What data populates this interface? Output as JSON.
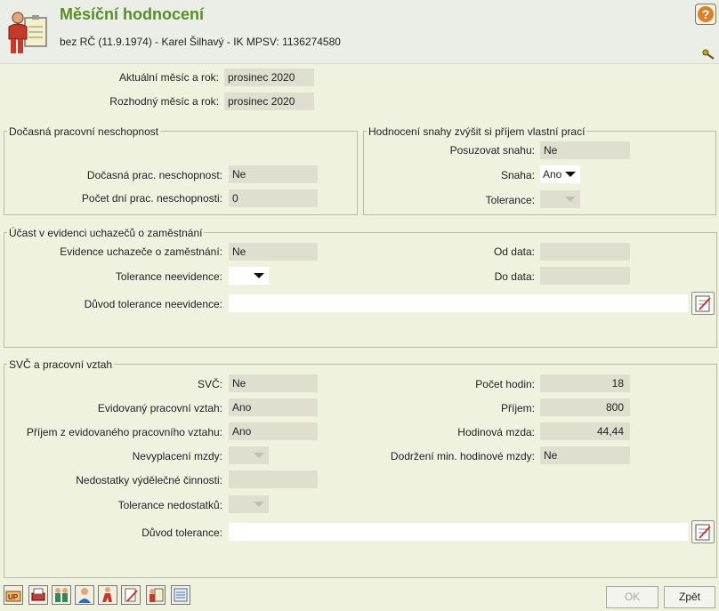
{
  "header": {
    "title": "Měsíční hodnocení",
    "subtitle": "bez RČ (11.9.1974) - Karel Šilhavý - IK MPSV: 1136274580",
    "help_label": "?"
  },
  "top": {
    "current_month_label": "Aktuální měsíc a rok:",
    "current_month_value": "prosinec 2020",
    "decisive_month_label": "Rozhodný měsíc a rok:",
    "decisive_month_value": "prosinec 2020"
  },
  "incapacity": {
    "legend": "Dočasná pracovní neschopnost",
    "incapacity_label": "Dočasná prac. neschopnost:",
    "incapacity_value": "Ne",
    "days_label": "Počet dní prac. neschopnosti:",
    "days_value": "0"
  },
  "effort": {
    "legend": "Hodnocení snahy zvýšit si příjem vlastní prací",
    "assess_label": "Posuzovat snahu:",
    "assess_value": "Ne",
    "effort_label": "Snaha:",
    "effort_value": "Ano",
    "tolerance_label": "Tolerance:",
    "tolerance_value": ""
  },
  "registry": {
    "legend": "Účast v evidenci uchazečů o zaměstnání",
    "evidence_label": "Evidence uchazeče o zaměstnání:",
    "evidence_value": "Ne",
    "from_label": "Od data:",
    "from_value": "",
    "tolerance_label": "Tolerance neevidence:",
    "tolerance_value": "",
    "to_label": "Do data:",
    "to_value": "",
    "reason_label": "Důvod tolerance neevidence:",
    "reason_value": ""
  },
  "svc": {
    "legend": "SVČ a pracovní vztah",
    "svc_label": "SVČ:",
    "svc_value": "Ne",
    "hours_label": "Počet hodin:",
    "hours_value": "18",
    "employment_label": "Evidovaný pracovní vztah:",
    "employment_value": "Ano",
    "income_label": "Příjem:",
    "income_value": "800",
    "income_from_label": "Příjem z evidovaného pracovního vztahu:",
    "income_from_value": "Ano",
    "hourly_label": "Hodinová mzda:",
    "hourly_value": "44,44",
    "nonpayment_label": "Nevyplacení mzdy:",
    "nonpayment_value": "",
    "min_wage_label": "Dodržení min. hodinové mzdy:",
    "min_wage_value": "Ne",
    "shortcomings_label": "Nedostatky výdělečné činnosti:",
    "shortcomings_value": "",
    "shortcomings_tol_label": "Tolerance nedostatků:",
    "shortcomings_tol_value": "",
    "reason_label": "Důvod tolerance:",
    "reason_value": ""
  },
  "footer": {
    "ok_label": "OK",
    "back_label": "Zpět",
    "icons": [
      "up-icon",
      "printer-icon",
      "family-icon",
      "person-icon",
      "walking-person-icon",
      "edit-document-icon",
      "person-document-icon",
      "list-icon"
    ]
  },
  "colors": {
    "background": "#eef2df",
    "title": "#5b8c2a",
    "readonly_field": "#dedfcf"
  }
}
